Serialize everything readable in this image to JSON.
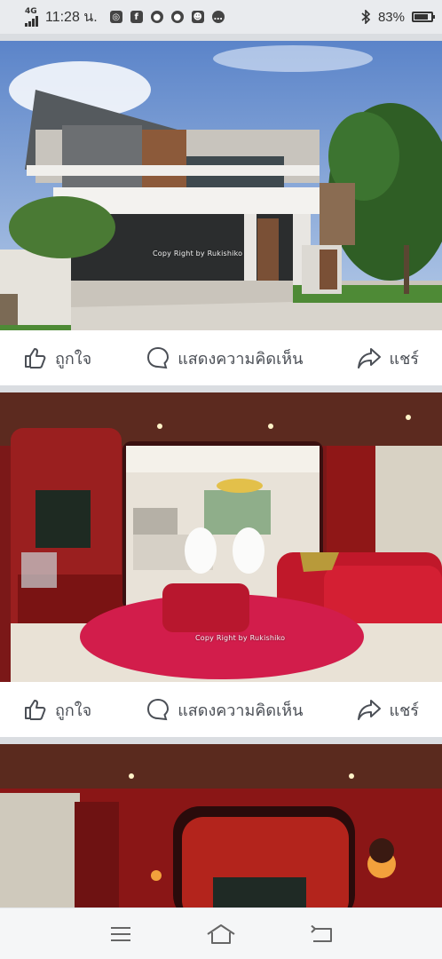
{
  "status_bar": {
    "network": "4G",
    "time": "11:28 น.",
    "app_icons": [
      "instagram-icon",
      "facebook-icon",
      "line-icon",
      "line-icon",
      "people-icon",
      "message-icon"
    ],
    "bluetooth_icon": "bluetooth-icon",
    "battery_text": "83%",
    "battery_level": 0.83
  },
  "posts": [
    {
      "photo": "house-exterior",
      "watermark": "Copy Right by Rukishiko",
      "actions": {
        "like_label": "ถูกใจ",
        "comment_label": "แสดงความคิดเห็น",
        "share_label": "แชร์"
      }
    },
    {
      "photo": "red-living-room",
      "watermark": "Copy Right by Rukishiko",
      "actions": {
        "like_label": "ถูกใจ",
        "comment_label": "แสดงความคิดเห็น",
        "share_label": "แชร์"
      }
    },
    {
      "photo": "red-room-partial"
    }
  ],
  "nav_bar": {
    "buttons": [
      "menu-icon",
      "home-icon",
      "back-icon"
    ]
  },
  "colors": {
    "action_text": "#4b4f56",
    "separator": "#dadde1",
    "room_red": "#8c1d1d"
  }
}
